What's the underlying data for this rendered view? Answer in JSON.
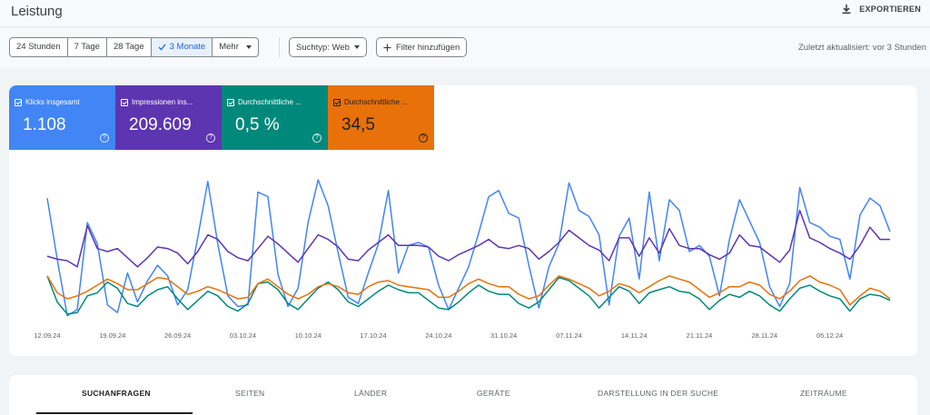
{
  "header": {
    "title": "Leistung",
    "export_label": "EXPORTIEREN"
  },
  "filters": {
    "date_ranges": [
      {
        "label": "24 Stunden",
        "active": false
      },
      {
        "label": "7 Tage",
        "active": false
      },
      {
        "label": "28 Tage",
        "active": false
      },
      {
        "label": "3 Monate",
        "active": true
      },
      {
        "label": "Mehr",
        "active": false
      }
    ],
    "search_type": "Suchtyp: Web",
    "add_filter": "Filter hinzufügen",
    "updated": "Zuletzt aktualisiert: vor 3 Stunden"
  },
  "metrics": [
    {
      "label": "Klicks insgesamt",
      "value": "1.108",
      "color": "#4285f4"
    },
    {
      "label": "Impressionen ins...",
      "value": "209.609",
      "color": "#5e35b1"
    },
    {
      "label": "Durchschnittliche ...",
      "value": "0,5 %",
      "color": "#00897b"
    },
    {
      "label": "Durchschnittliche ...",
      "value": "34,5",
      "color": "#e8710a"
    }
  ],
  "chart_data": {
    "type": "line",
    "x_ticks": [
      "12.09.24",
      "19.09.24",
      "26.09.24",
      "03.10.24",
      "10.10.24",
      "17.10.24",
      "24.10.24",
      "31.10.24",
      "07.11.24",
      "14.11.24",
      "21.11.24",
      "28.11.24",
      "05.12.24"
    ],
    "series": [
      {
        "name": "Klicks insgesamt",
        "color": "#4285f4",
        "values": [
          0.82,
          0.42,
          0.05,
          0.09,
          0.66,
          0.52,
          0.12,
          0.07,
          0.33,
          0.14,
          0.28,
          0.38,
          0.31,
          0.12,
          0.22,
          0.56,
          0.93,
          0.52,
          0.18,
          0.11,
          0.12,
          0.86,
          0.83,
          0.32,
          0.11,
          0.23,
          0.66,
          0.94,
          0.77,
          0.46,
          0.17,
          0.13,
          0.33,
          0.52,
          0.87,
          0.33,
          0.51,
          0.53,
          0.5,
          0.25,
          0.09,
          0.23,
          0.37,
          0.59,
          0.83,
          0.87,
          0.72,
          0.69,
          0.38,
          0.1,
          0.37,
          0.52,
          0.92,
          0.74,
          0.7,
          0.58,
          0.12,
          0.57,
          0.69,
          0.29,
          0.86,
          0.41,
          0.81,
          0.74,
          0.47,
          0.51,
          0.44,
          0.18,
          0.55,
          0.81,
          0.67,
          0.53,
          0.24,
          0.11,
          0.26,
          0.89,
          0.66,
          0.63,
          0.57,
          0.55,
          0.29,
          0.71,
          0.82,
          0.77,
          0.6
        ]
      },
      {
        "name": "Impressionen ins...",
        "color": "#5e35b1",
        "values": [
          0.44,
          0.42,
          0.41,
          0.37,
          0.64,
          0.49,
          0.47,
          0.49,
          0.43,
          0.37,
          0.43,
          0.5,
          0.49,
          0.46,
          0.39,
          0.47,
          0.58,
          0.55,
          0.47,
          0.43,
          0.41,
          0.49,
          0.57,
          0.52,
          0.46,
          0.4,
          0.49,
          0.58,
          0.55,
          0.5,
          0.42,
          0.41,
          0.48,
          0.53,
          0.58,
          0.51,
          0.51,
          0.51,
          0.5,
          0.44,
          0.41,
          0.45,
          0.48,
          0.51,
          0.55,
          0.5,
          0.49,
          0.51,
          0.49,
          0.42,
          0.47,
          0.53,
          0.61,
          0.56,
          0.51,
          0.48,
          0.41,
          0.56,
          0.56,
          0.44,
          0.56,
          0.46,
          0.62,
          0.51,
          0.49,
          0.49,
          0.45,
          0.42,
          0.46,
          0.58,
          0.51,
          0.5,
          0.45,
          0.4,
          0.48,
          0.74,
          0.56,
          0.53,
          0.49,
          0.46,
          0.42,
          0.51,
          0.63,
          0.55,
          0.55
        ]
      },
      {
        "name": "Durchschnittliche ... (CTR)",
        "color": "#00897b",
        "values": [
          0.31,
          0.14,
          0.06,
          0.07,
          0.18,
          0.2,
          0.27,
          0.23,
          0.13,
          0.11,
          0.18,
          0.22,
          0.24,
          0.16,
          0.09,
          0.15,
          0.21,
          0.18,
          0.11,
          0.08,
          0.13,
          0.26,
          0.27,
          0.22,
          0.13,
          0.09,
          0.16,
          0.23,
          0.27,
          0.22,
          0.14,
          0.11,
          0.16,
          0.21,
          0.25,
          0.22,
          0.2,
          0.2,
          0.15,
          0.1,
          0.09,
          0.14,
          0.2,
          0.25,
          0.21,
          0.19,
          0.19,
          0.13,
          0.1,
          0.14,
          0.22,
          0.3,
          0.28,
          0.23,
          0.18,
          0.1,
          0.17,
          0.24,
          0.21,
          0.13,
          0.2,
          0.22,
          0.24,
          0.21,
          0.2,
          0.16,
          0.09,
          0.15,
          0.19,
          0.17,
          0.21,
          0.18,
          0.12,
          0.08,
          0.16,
          0.23,
          0.25,
          0.21,
          0.18,
          0.16,
          0.08,
          0.16,
          0.19,
          0.18,
          0.15
        ]
      },
      {
        "name": "Durchschnittliche ... (Position)",
        "color": "#e8710a",
        "values": [
          0.31,
          0.2,
          0.16,
          0.18,
          0.21,
          0.25,
          0.29,
          0.26,
          0.22,
          0.22,
          0.26,
          0.3,
          0.29,
          0.24,
          0.19,
          0.21,
          0.24,
          0.22,
          0.19,
          0.16,
          0.17,
          0.26,
          0.29,
          0.24,
          0.19,
          0.16,
          0.19,
          0.24,
          0.26,
          0.24,
          0.2,
          0.19,
          0.24,
          0.27,
          0.28,
          0.25,
          0.24,
          0.23,
          0.22,
          0.17,
          0.17,
          0.21,
          0.26,
          0.29,
          0.26,
          0.24,
          0.24,
          0.19,
          0.16,
          0.18,
          0.25,
          0.31,
          0.29,
          0.26,
          0.23,
          0.18,
          0.21,
          0.26,
          0.24,
          0.2,
          0.24,
          0.28,
          0.31,
          0.29,
          0.27,
          0.22,
          0.17,
          0.2,
          0.24,
          0.24,
          0.27,
          0.25,
          0.19,
          0.16,
          0.21,
          0.28,
          0.31,
          0.27,
          0.25,
          0.22,
          0.12,
          0.18,
          0.23,
          0.21,
          0.16
        ]
      }
    ]
  },
  "tabs": [
    {
      "label": "SUCHANFRAGEN",
      "active": true
    },
    {
      "label": "SEITEN",
      "active": false
    },
    {
      "label": "LÄNDER",
      "active": false
    },
    {
      "label": "GERÄTE",
      "active": false
    },
    {
      "label": "DARSTELLUNG IN DER SUCHE",
      "active": false
    },
    {
      "label": "ZEITRÄUME",
      "active": false
    }
  ]
}
